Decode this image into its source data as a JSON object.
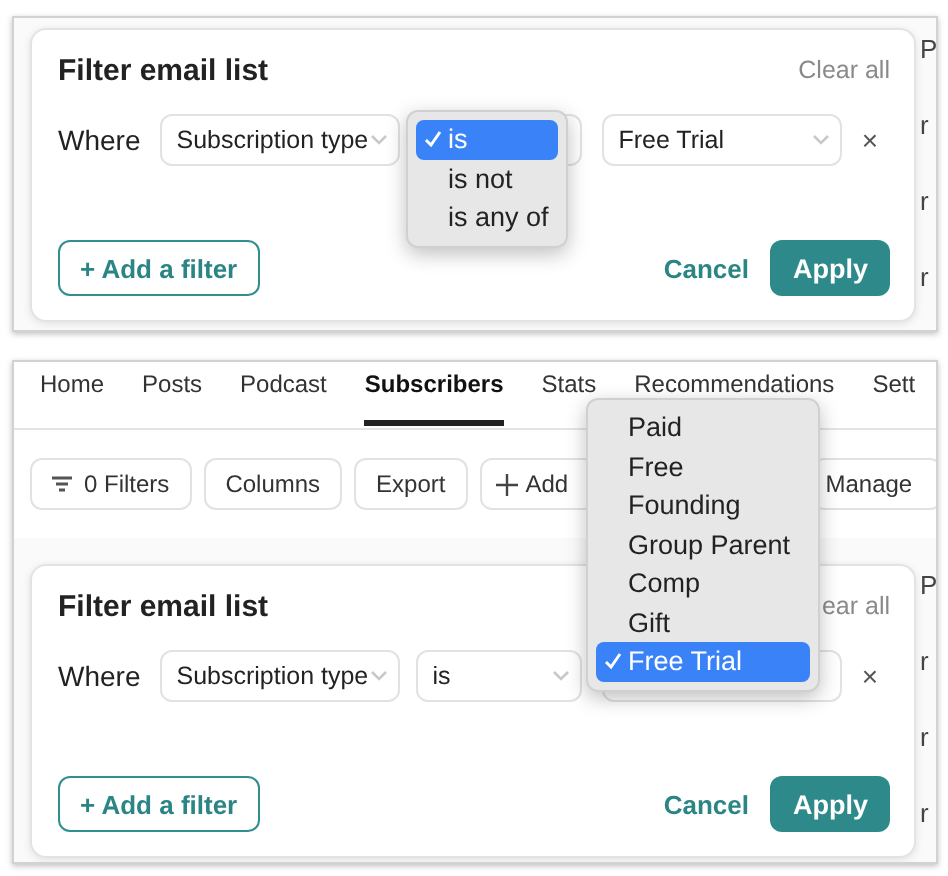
{
  "top_screenshot": {
    "filter_panel": {
      "title": "Filter email list",
      "clear_all": "Clear all",
      "where": "Where",
      "field": "Subscription type",
      "value": "Free Trial",
      "remove": "×",
      "add_filter": "+ Add a filter",
      "cancel": "Cancel",
      "apply": "Apply"
    },
    "operator_menu": [
      {
        "label": "is",
        "selected": true
      },
      {
        "label": "is not",
        "selected": false
      },
      {
        "label": "is any of",
        "selected": false
      }
    ],
    "edge_letters": [
      "P",
      "r",
      "r",
      "r"
    ]
  },
  "bottom_screenshot": {
    "tabs": [
      {
        "label": "Home",
        "selected": false
      },
      {
        "label": "Posts",
        "selected": false
      },
      {
        "label": "Podcast",
        "selected": false
      },
      {
        "label": "Subscribers",
        "selected": true
      },
      {
        "label": "Stats",
        "selected": false
      },
      {
        "label": "Recommendations",
        "selected": false
      },
      {
        "label": "Sett",
        "selected": false
      }
    ],
    "toolbar": [
      {
        "kind": "filter",
        "label": "0 Filters"
      },
      {
        "kind": "plain",
        "label": "Columns"
      },
      {
        "kind": "plain",
        "label": "Export"
      },
      {
        "kind": "add",
        "label": "Add"
      },
      {
        "kind": "plain",
        "label": "Manage"
      }
    ],
    "filter_panel": {
      "title": "Filter email list",
      "clear_all": "ear all",
      "where": "Where",
      "field": "Subscription type",
      "operator": "is",
      "remove": "×",
      "add_filter": "+ Add a filter",
      "cancel": "Cancel",
      "apply": "Apply"
    },
    "value_menu": [
      {
        "label": "Paid",
        "selected": false
      },
      {
        "label": "Free",
        "selected": false
      },
      {
        "label": "Founding",
        "selected": false
      },
      {
        "label": "Group Parent",
        "selected": false
      },
      {
        "label": "Comp",
        "selected": false
      },
      {
        "label": "Gift",
        "selected": false
      },
      {
        "label": "Free Trial",
        "selected": true
      }
    ],
    "edge_letters": [
      "P",
      "r",
      "r",
      "r"
    ]
  }
}
